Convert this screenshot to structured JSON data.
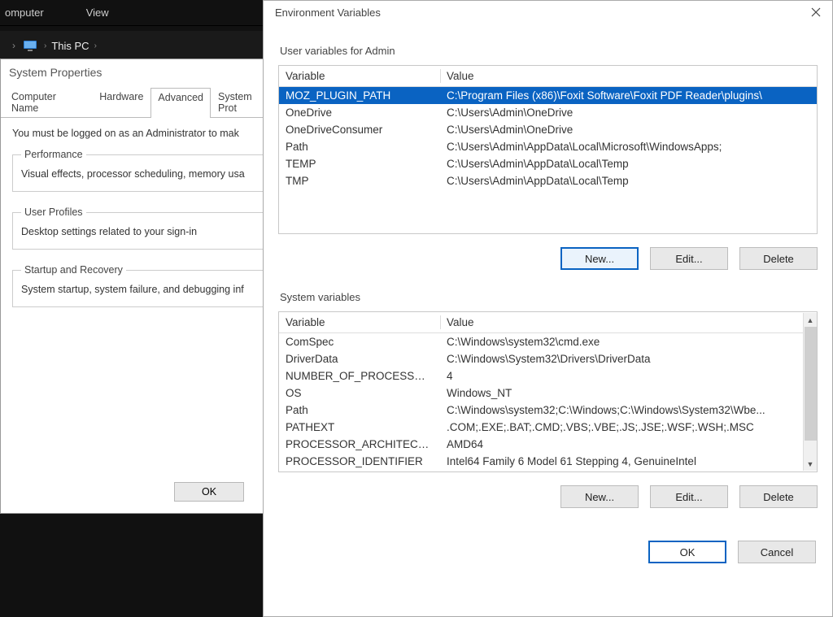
{
  "explorer": {
    "tabs": {
      "computer": "omputer",
      "view": "View"
    },
    "breadcrumb": {
      "thispc": "This PC"
    }
  },
  "sysprops": {
    "title": "System Properties",
    "tabs": {
      "computer_name": "Computer Name",
      "hardware": "Hardware",
      "advanced": "Advanced",
      "system_protection": "System Prot"
    },
    "note": "You must be logged on as an Administrator to mak",
    "performance": {
      "legend": "Performance",
      "text": "Visual effects, processor scheduling, memory usa"
    },
    "user_profiles": {
      "legend": "User Profiles",
      "text": "Desktop settings related to your sign-in"
    },
    "startup": {
      "legend": "Startup and Recovery",
      "text": "System startup, system failure, and debugging inf"
    },
    "ok": "OK"
  },
  "env": {
    "title": "Environment Variables",
    "user_group": "User variables for Admin",
    "sys_group": "System variables",
    "col_var": "Variable",
    "col_val": "Value",
    "user_vars": [
      {
        "name": "MOZ_PLUGIN_PATH",
        "value": "C:\\Program Files (x86)\\Foxit Software\\Foxit PDF Reader\\plugins\\"
      },
      {
        "name": "OneDrive",
        "value": "C:\\Users\\Admin\\OneDrive"
      },
      {
        "name": "OneDriveConsumer",
        "value": "C:\\Users\\Admin\\OneDrive"
      },
      {
        "name": "Path",
        "value": "C:\\Users\\Admin\\AppData\\Local\\Microsoft\\WindowsApps;"
      },
      {
        "name": "TEMP",
        "value": "C:\\Users\\Admin\\AppData\\Local\\Temp"
      },
      {
        "name": "TMP",
        "value": "C:\\Users\\Admin\\AppData\\Local\\Temp"
      }
    ],
    "sys_vars": [
      {
        "name": "ComSpec",
        "value": "C:\\Windows\\system32\\cmd.exe"
      },
      {
        "name": "DriverData",
        "value": "C:\\Windows\\System32\\Drivers\\DriverData"
      },
      {
        "name": "NUMBER_OF_PROCESSORS",
        "value": "4"
      },
      {
        "name": "OS",
        "value": "Windows_NT"
      },
      {
        "name": "Path",
        "value": "C:\\Windows\\system32;C:\\Windows;C:\\Windows\\System32\\Wbe..."
      },
      {
        "name": "PATHEXT",
        "value": ".COM;.EXE;.BAT;.CMD;.VBS;.VBE;.JS;.JSE;.WSF;.WSH;.MSC"
      },
      {
        "name": "PROCESSOR_ARCHITECTURE",
        "value": "AMD64"
      },
      {
        "name": "PROCESSOR_IDENTIFIER",
        "value": "Intel64 Family 6 Model 61 Stepping 4, GenuineIntel"
      }
    ],
    "buttons": {
      "new": "New...",
      "edit": "Edit...",
      "delete": "Delete",
      "ok": "OK",
      "cancel": "Cancel"
    }
  }
}
